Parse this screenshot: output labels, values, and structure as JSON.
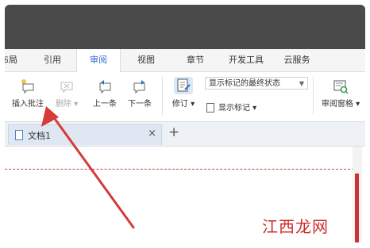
{
  "menu_tabs": [
    {
      "label": "布局"
    },
    {
      "label": "引用"
    },
    {
      "label": "审阅"
    },
    {
      "label": "视图"
    },
    {
      "label": "章节"
    },
    {
      "label": "开发工具"
    },
    {
      "label": "云服务"
    }
  ],
  "ribbon": {
    "insert_comment": "插入批注",
    "delete": "删除",
    "previous": "上一条",
    "next": "下一条",
    "track_changes": "修订",
    "show_markup": "显示标记",
    "markup_mode_select": "显示标记的最终状态",
    "review_pane": "审阅窗格"
  },
  "doc_tab": {
    "name": "文档1"
  },
  "watermark": "江西龙网",
  "colors": {
    "accent": "#2f6fd0",
    "arrow": "#d63a3a",
    "titlebar": "#4a4a4a"
  }
}
